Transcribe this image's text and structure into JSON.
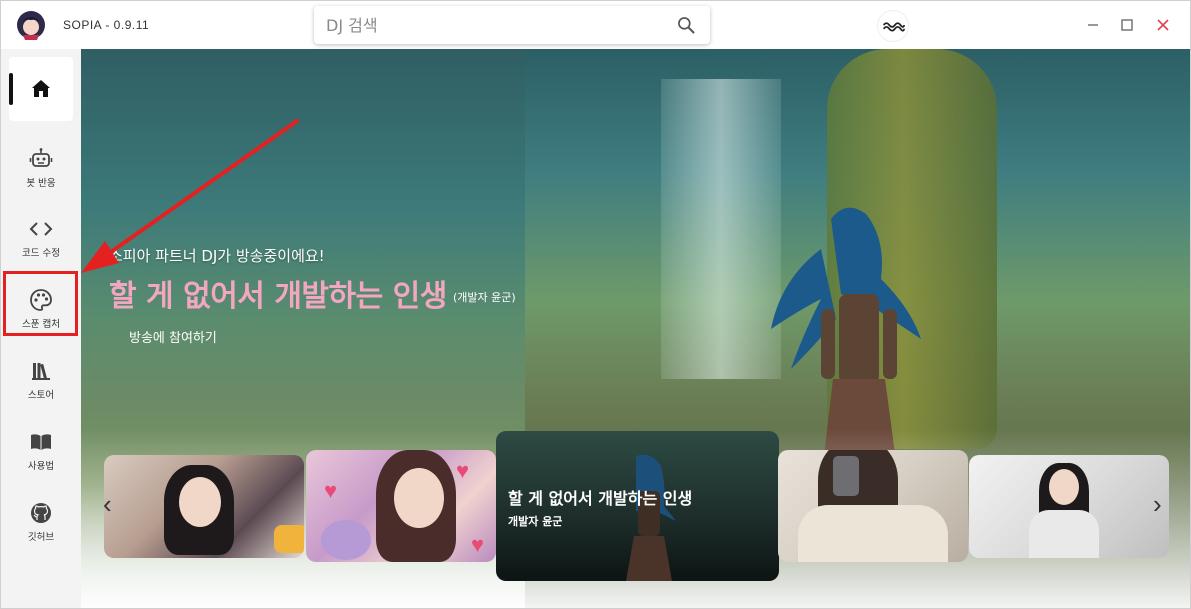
{
  "app": {
    "title": "SOPIA - 0.9.11"
  },
  "search": {
    "placeholder": "DJ 검색",
    "value": ""
  },
  "sidebar": {
    "items": [
      {
        "id": "home",
        "label": ""
      },
      {
        "id": "bot",
        "label": "봇 반응"
      },
      {
        "id": "code",
        "label": "코드 수정"
      },
      {
        "id": "capture",
        "label": "스푼 캡처"
      },
      {
        "id": "store",
        "label": "스토어"
      },
      {
        "id": "guide",
        "label": "사용법"
      },
      {
        "id": "github",
        "label": "깃허브"
      }
    ]
  },
  "hero": {
    "subtitle": "소피아 파트너 DJ가 방송중이에요!",
    "title": "할 게 없어서 개발하는 인생",
    "dj": "(개발자 윤군)",
    "join_label": "방송에 참여하기"
  },
  "carousel": {
    "active": {
      "title": "할 게 없어서 개발하는 인생",
      "dj": "개발자 윤군"
    },
    "prev_icon": "chevron-left-icon",
    "next_icon": "chevron-right-icon"
  },
  "colors": {
    "accent_pink": "#f3a6c0",
    "highlight_red": "#e52020",
    "sidebar_bg": "#f3f3f3"
  }
}
